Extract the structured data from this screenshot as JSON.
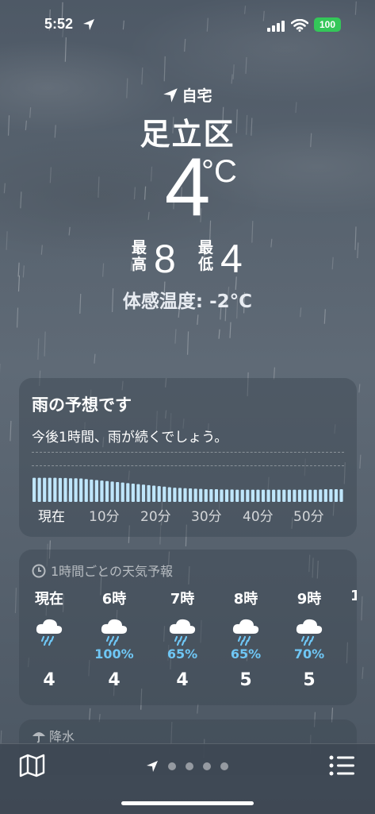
{
  "status_bar": {
    "time": "5:52",
    "battery": "100"
  },
  "location": {
    "label": "自宅",
    "city": "足立区"
  },
  "current": {
    "temp": "4",
    "unit": "°C",
    "high_label": "最高",
    "high": "8",
    "low_label": "最低",
    "low": "4",
    "feels_like": "体感温度: -2°C"
  },
  "rain_forecast": {
    "title": "雨の予想です",
    "subtitle": "今後1時間、雨が続くでしょう。",
    "minute_labels": [
      "現在",
      "10分",
      "20分",
      "30分",
      "40分",
      "50分"
    ],
    "intensity": [
      0.95,
      0.95,
      0.95,
      0.95,
      0.95,
      0.94,
      0.94,
      0.93,
      0.93,
      0.92,
      0.9,
      0.88,
      0.86,
      0.84,
      0.82,
      0.8,
      0.78,
      0.76,
      0.74,
      0.72,
      0.7,
      0.68,
      0.66,
      0.64,
      0.62,
      0.6,
      0.58,
      0.56,
      0.55,
      0.54,
      0.53,
      0.52,
      0.51,
      0.5,
      0.5,
      0.5,
      0.49,
      0.49,
      0.49,
      0.48,
      0.48,
      0.48,
      0.48,
      0.48,
      0.48,
      0.48,
      0.48,
      0.48,
      0.48,
      0.48,
      0.48,
      0.48,
      0.48,
      0.48,
      0.48,
      0.49,
      0.5,
      0.5,
      0.5,
      0.5
    ]
  },
  "hourly": {
    "title": "1時間ごとの天気予報",
    "items": [
      {
        "time": "現在",
        "pop": "",
        "temp": "4",
        "icon": "rain-cloud-icon"
      },
      {
        "time": "6時",
        "pop": "100%",
        "temp": "4",
        "icon": "rain-cloud-icon"
      },
      {
        "time": "7時",
        "pop": "65%",
        "temp": "4",
        "icon": "rain-cloud-icon"
      },
      {
        "time": "8時",
        "pop": "65%",
        "temp": "5",
        "icon": "rain-cloud-icon"
      },
      {
        "time": "9時",
        "pop": "70%",
        "temp": "5",
        "icon": "rain-cloud-icon"
      }
    ]
  },
  "precipitation": {
    "title": "降水"
  },
  "colors": {
    "precip": "#6fc7f5",
    "battery": "#34c759"
  }
}
